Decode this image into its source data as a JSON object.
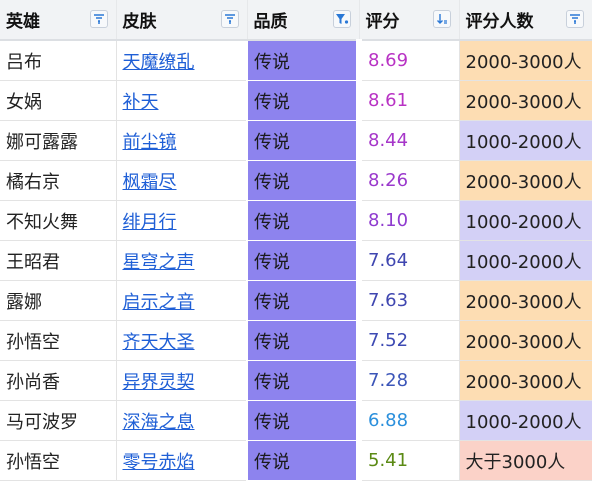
{
  "headers": {
    "hero": "英雄",
    "skin": "皮肤",
    "quality": "品质",
    "score": "评分",
    "count": "评分人数"
  },
  "colors": {
    "quality_bg": "#8d83ee",
    "count_2000_3000": "#fdddb3",
    "count_1000_2000": "#d3d0f6",
    "count_over_3000": "#fbd2c8",
    "link": "#1f5fd6"
  },
  "rows": [
    {
      "hero": "吕布",
      "skin": "天魔缭乱",
      "quality": "传说",
      "score": "8.69",
      "score_color": "#b832c4",
      "count": "2000-3000人",
      "count_bg": "#fdddb3"
    },
    {
      "hero": "女娲",
      "skin": "补天",
      "quality": "传说",
      "score": "8.61",
      "score_color": "#b832c4",
      "count": "2000-3000人",
      "count_bg": "#fdddb3"
    },
    {
      "hero": "娜可露露",
      "skin": "前尘镜",
      "quality": "传说",
      "score": "8.44",
      "score_color": "#a636c9",
      "count": "1000-2000人",
      "count_bg": "#d3d0f6"
    },
    {
      "hero": "橘右京",
      "skin": "枫霜尽",
      "quality": "传说",
      "score": "8.26",
      "score_color": "#9a38cc",
      "count": "2000-3000人",
      "count_bg": "#fdddb3"
    },
    {
      "hero": "不知火舞",
      "skin": "绯月行",
      "quality": "传说",
      "score": "8.10",
      "score_color": "#8f3bcf",
      "count": "1000-2000人",
      "count_bg": "#d3d0f6"
    },
    {
      "hero": "王昭君",
      "skin": "星穹之声",
      "quality": "传说",
      "score": "7.64",
      "score_color": "#3f46b0",
      "count": "1000-2000人",
      "count_bg": "#d3d0f6"
    },
    {
      "hero": "露娜",
      "skin": "启示之音",
      "quality": "传说",
      "score": "7.63",
      "score_color": "#3f46b0",
      "count": "2000-3000人",
      "count_bg": "#fdddb3"
    },
    {
      "hero": "孙悟空",
      "skin": "齐天大圣",
      "quality": "传说",
      "score": "7.52",
      "score_color": "#3d4ab3",
      "count": "2000-3000人",
      "count_bg": "#fdddb3"
    },
    {
      "hero": "孙尚香",
      "skin": "异界灵契",
      "quality": "传说",
      "score": "7.28",
      "score_color": "#3b55b8",
      "count": "2000-3000人",
      "count_bg": "#fdddb3"
    },
    {
      "hero": "马可波罗",
      "skin": "深海之息",
      "quality": "传说",
      "score": "6.88",
      "score_color": "#2a8fdc",
      "count": "1000-2000人",
      "count_bg": "#d3d0f6"
    },
    {
      "hero": "孙悟空",
      "skin": "零号赤焰",
      "quality": "传说",
      "score": "5.41",
      "score_color": "#5b8a14",
      "count": "大于3000人",
      "count_bg": "#fbd2c8"
    }
  ]
}
